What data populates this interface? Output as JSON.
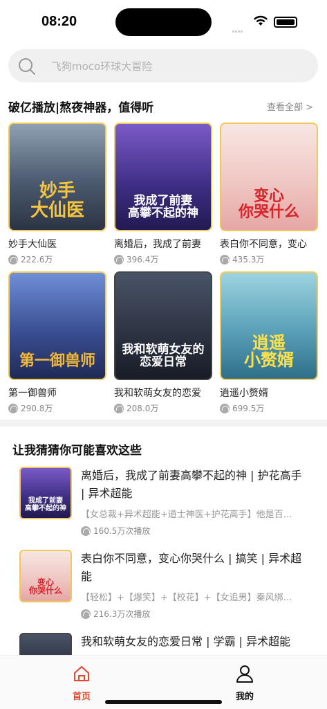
{
  "status": {
    "time": "08:20"
  },
  "search": {
    "placeholder": "飞狗moco环球大冒险"
  },
  "section1": {
    "title": "破亿播放|熬夜神器，值得听",
    "see_all": "查看全部 >",
    "cards": [
      {
        "name": "妙手大仙医",
        "plays": "222.6万",
        "cover_text": "妙手\n大仙医",
        "bg": "#5a6b7e",
        "fg": "#f5c542"
      },
      {
        "name": "离婚后，我成了前妻",
        "plays": "396.4万",
        "cover_text": "我成了前妻\n高攀不起的神",
        "bg": "#4a3d8f",
        "fg": "#ffffff"
      },
      {
        "name": "表白你不同意，变心",
        "plays": "435.3万",
        "cover_text": "变心\n你哭什么",
        "bg": "#f3d7d4",
        "fg": "#d8232a"
      },
      {
        "name": "第一御兽师",
        "plays": "290.8万",
        "cover_text": "第一御兽师",
        "bg": "#3b4f8f",
        "fg": "#f2b83a"
      },
      {
        "name": "我和软萌女友的恋爱",
        "plays": "208.0万",
        "cover_text": "我和软萌女友的\n恋爱日常",
        "bg": "#2b3140",
        "fg": "#ffffff"
      },
      {
        "name": "逍遥小赘婿",
        "plays": "699.5万",
        "cover_text": "逍遥\n小赘婿",
        "bg": "#5aa0b8",
        "fg": "#ffe14a"
      }
    ]
  },
  "section2": {
    "title": "让我猜猜你可能喜欢这些",
    "items": [
      {
        "title": "离婚后，我成了前妻高攀不起的神 | 护花高手 | 异术超能",
        "desc": "【女总裁+异术超能+道士神医+护花高手】他是百…",
        "plays": "160.5万次播放",
        "thumb_text": "我成了前妻\n高攀不起的神",
        "bg": "#4a3d8f",
        "fg": "#ffffff"
      },
      {
        "title": "表白你不同意，变心你哭什么 | 搞笑 | 异术超能",
        "desc": "【轻松】+【爆笑】+【校花】+【女追男】秦风绑…",
        "plays": "216.3万次播放",
        "thumb_text": "变心\n你哭什么",
        "bg": "#f3d7d4",
        "fg": "#d8232a"
      },
      {
        "title": "我和软萌女友的恋爱日常 | 学霸 | 异术超能",
        "desc": "",
        "plays": "",
        "thumb_text": "",
        "bg": "#2b3140",
        "fg": "#ffffff"
      }
    ]
  },
  "tabbar": {
    "home_label": "首页",
    "mine_label": "我的",
    "accent": "#e8452c"
  }
}
